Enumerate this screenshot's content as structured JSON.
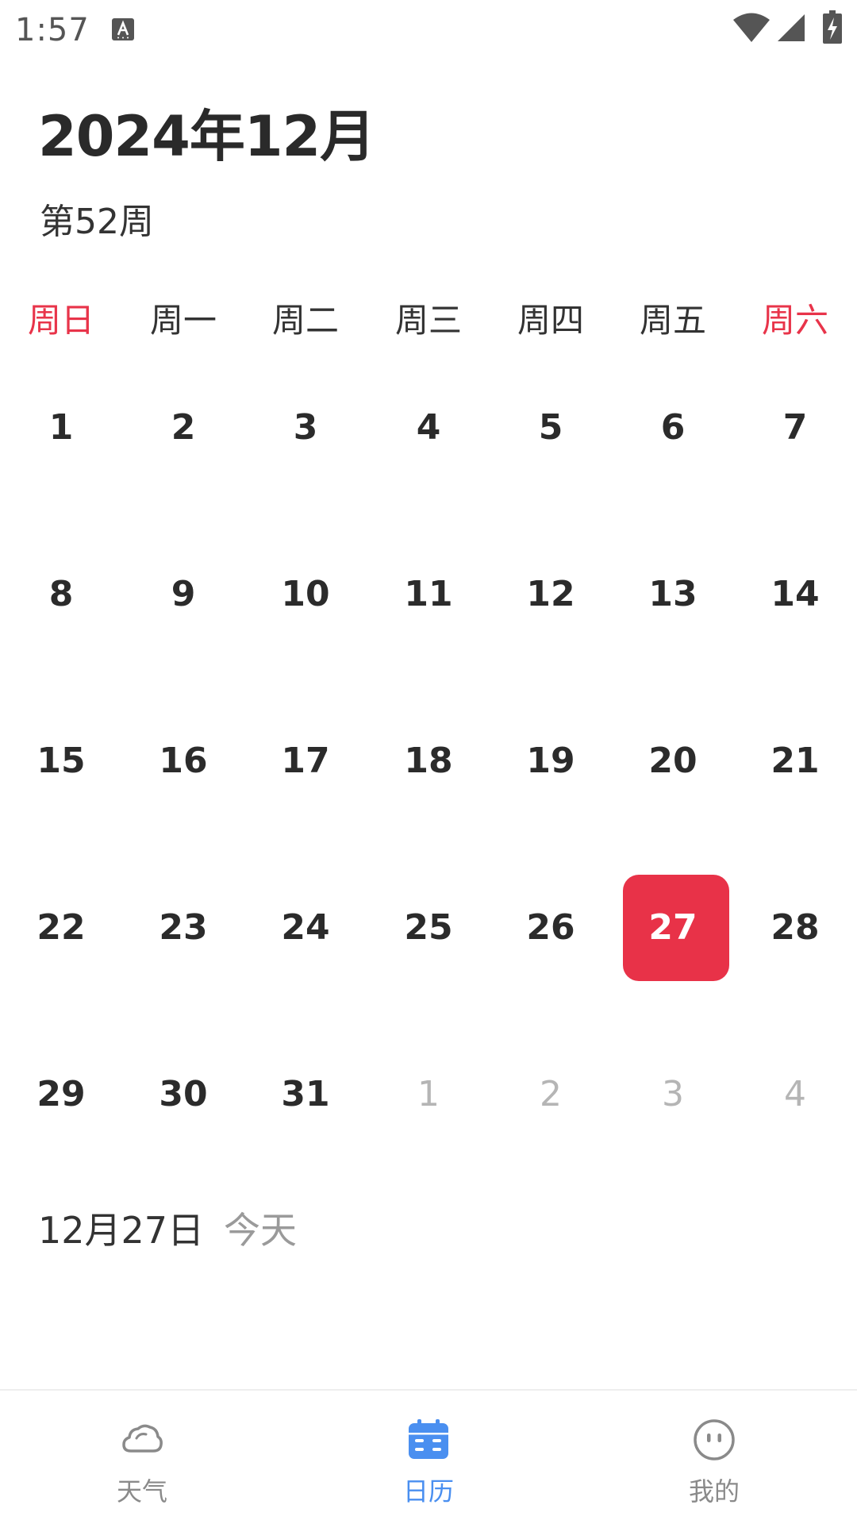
{
  "status_bar": {
    "time": "1:57",
    "icons": [
      "text-a-icon",
      "wifi-icon",
      "cell-signal-icon",
      "battery-charging-icon"
    ]
  },
  "header": {
    "month_title": "2024年12月",
    "week_label": "第52周"
  },
  "weekdays": [
    {
      "label": "周日",
      "weekend": true
    },
    {
      "label": "周一",
      "weekend": false
    },
    {
      "label": "周二",
      "weekend": false
    },
    {
      "label": "周三",
      "weekend": false
    },
    {
      "label": "周四",
      "weekend": false
    },
    {
      "label": "周五",
      "weekend": false
    },
    {
      "label": "周六",
      "weekend": true
    }
  ],
  "calendar": {
    "weeks": [
      [
        {
          "day": "1",
          "in_month": true
        },
        {
          "day": "2",
          "in_month": true
        },
        {
          "day": "3",
          "in_month": true
        },
        {
          "day": "4",
          "in_month": true
        },
        {
          "day": "5",
          "in_month": true
        },
        {
          "day": "6",
          "in_month": true
        },
        {
          "day": "7",
          "in_month": true
        }
      ],
      [
        {
          "day": "8",
          "in_month": true
        },
        {
          "day": "9",
          "in_month": true
        },
        {
          "day": "10",
          "in_month": true
        },
        {
          "day": "11",
          "in_month": true
        },
        {
          "day": "12",
          "in_month": true
        },
        {
          "day": "13",
          "in_month": true
        },
        {
          "day": "14",
          "in_month": true
        }
      ],
      [
        {
          "day": "15",
          "in_month": true
        },
        {
          "day": "16",
          "in_month": true
        },
        {
          "day": "17",
          "in_month": true
        },
        {
          "day": "18",
          "in_month": true
        },
        {
          "day": "19",
          "in_month": true
        },
        {
          "day": "20",
          "in_month": true
        },
        {
          "day": "21",
          "in_month": true
        }
      ],
      [
        {
          "day": "22",
          "in_month": true
        },
        {
          "day": "23",
          "in_month": true
        },
        {
          "day": "24",
          "in_month": true
        },
        {
          "day": "25",
          "in_month": true
        },
        {
          "day": "26",
          "in_month": true
        },
        {
          "day": "27",
          "in_month": true,
          "selected": true
        },
        {
          "day": "28",
          "in_month": true
        }
      ],
      [
        {
          "day": "29",
          "in_month": true
        },
        {
          "day": "30",
          "in_month": true
        },
        {
          "day": "31",
          "in_month": true
        },
        {
          "day": "1",
          "in_month": false
        },
        {
          "day": "2",
          "in_month": false
        },
        {
          "day": "3",
          "in_month": false
        },
        {
          "day": "4",
          "in_month": false
        }
      ]
    ]
  },
  "selected_info": {
    "date": "12月27日",
    "relative": "今天"
  },
  "bottom_nav": {
    "items": [
      {
        "label": "天气",
        "icon": "cloud-icon",
        "active": false
      },
      {
        "label": "日历",
        "icon": "calendar-icon",
        "active": true
      },
      {
        "label": "我的",
        "icon": "face-icon",
        "active": false
      }
    ]
  },
  "colors": {
    "accent_red": "#e83248",
    "weekend_red": "#e8344a",
    "active_blue": "#4a8ff0",
    "inactive_gray": "#8a8a8a",
    "other_month_gray": "#b5b5b5"
  }
}
